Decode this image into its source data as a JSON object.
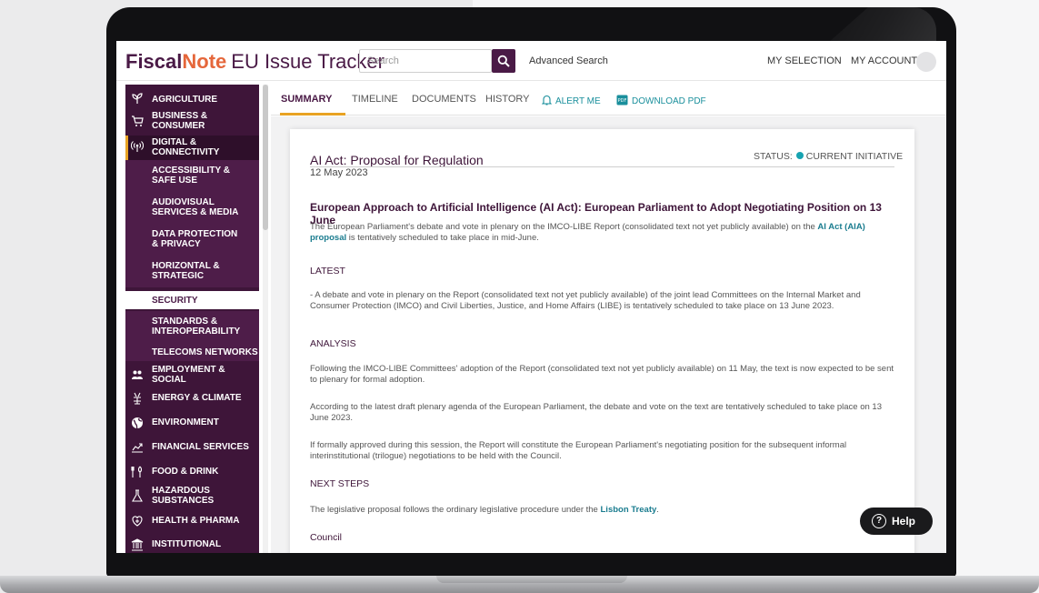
{
  "header": {
    "brand_part1": "Fiscal",
    "brand_part2": "Note",
    "brand_part3": "EU Issue Tracker",
    "search_placeholder": "Search",
    "advanced_search": "Advanced Search",
    "my_selection": "MY SELECTION",
    "my_account": "MY ACCOUNT"
  },
  "sidebar": {
    "items": [
      {
        "label": "AGRICULTURE",
        "icon": "plant-icon"
      },
      {
        "label": "BUSINESS & CONSUMER",
        "icon": "cart-icon"
      },
      {
        "label": "DIGITAL & CONNECTIVITY",
        "icon": "signal-icon"
      },
      {
        "label": "EMPLOYMENT & SOCIAL",
        "icon": "people-icon"
      },
      {
        "label": "ENERGY & CLIMATE",
        "icon": "energy-icon"
      },
      {
        "label": "ENVIRONMENT",
        "icon": "globe-icon"
      },
      {
        "label": "FINANCIAL SERVICES",
        "icon": "finance-icon"
      },
      {
        "label": "FOOD & DRINK",
        "icon": "food-icon"
      },
      {
        "label": "HAZARDOUS SUBSTANCES",
        "icon": "flask-icon"
      },
      {
        "label": "HEALTH & PHARMA",
        "icon": "health-icon"
      },
      {
        "label": "INSTITUTIONAL",
        "icon": "institution-icon"
      }
    ],
    "subitems": [
      {
        "label": "ACCESSIBILITY & SAFE USE"
      },
      {
        "label": "AUDIOVISUAL SERVICES & MEDIA"
      },
      {
        "label": "DATA PROTECTION & PRIVACY"
      },
      {
        "label": "HORIZONTAL & STRATEGIC"
      },
      {
        "label": "SECURITY"
      },
      {
        "label": "STANDARDS & INTEROPERABILITY"
      },
      {
        "label": "TELECOMS NETWORKS"
      }
    ],
    "accent_color": "#e8a323"
  },
  "tabs": {
    "summary": "SUMMARY",
    "timeline": "TIMELINE",
    "documents": "DOCUMENTS",
    "history": "HISTORY",
    "alert_me": "ALERT ME",
    "download_pdf": "DOWNLOAD PDF"
  },
  "document": {
    "title": "AI Act: Proposal for Regulation",
    "date": "12 May 2023",
    "status_label": "STATUS:",
    "status_value": "CURRENT INITIATIVE",
    "status_color": "#17a3b1",
    "headline": "European Approach to Artificial Intelligence (AI Act): European Parliament to Adopt Negotiating Position on 13 June",
    "intro_text": "The European Parliament's debate and vote in plenary on the IMCO-LIBE Report (consolidated text not yet publicly available) on the",
    "intro_link": "AI Act (AIA) proposal",
    "intro_tail": "is tentatively scheduled to take place in mid-June.",
    "latest_head": "LATEST",
    "latest_text": "- A debate and vote in plenary on the Report (consolidated text not yet publicly available) of the joint lead Committees on the Internal Market and Consumer Protection (IMCO) and Civil Liberties, Justice, and Home Affairs (LIBE) is tentatively scheduled to take place on 13 June 2023.",
    "analysis_head": "ANALYSIS",
    "analysis_p1": "Following the IMCO-LIBE Committees' adoption of the Report (consolidated text not yet publicly available) on 11 May, the text is now expected to be sent to plenary for formal adoption.",
    "analysis_p2": "According to the latest draft plenary agenda of the European Parliament, the debate and vote on the text are tentatively scheduled to take place on 13 June 2023.",
    "analysis_p3": "If formally approved during this session, the Report will constitute the European Parliament's negotiating position for the subsequent informal interinstitutional (trilogue) negotiations to be held with the Council.",
    "next_head": "NEXT STEPS",
    "next_text": "The legislative proposal follows the ordinary legislative procedure under the",
    "next_link": "Lisbon Treaty",
    "council_head": "Council"
  },
  "help": {
    "label": "Help"
  }
}
